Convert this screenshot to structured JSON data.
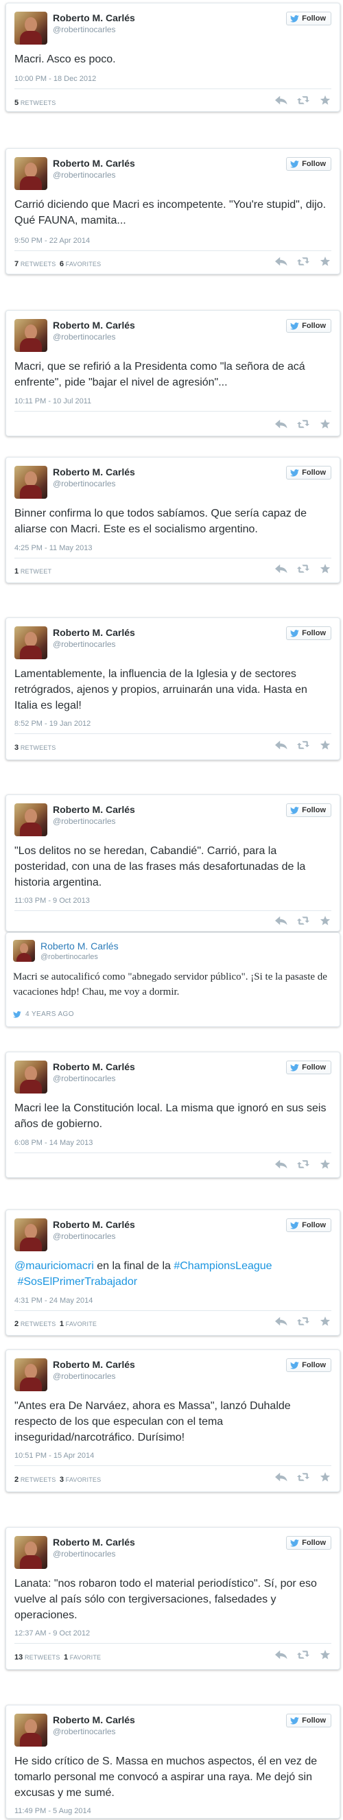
{
  "colors": {
    "link": "#1b95e0",
    "muted": "#8899a6",
    "text": "#292f33",
    "twitter_blue": "#55acee"
  },
  "follow_label": "Follow",
  "tweets": [
    {
      "name": "Roberto M. Carlés",
      "handle": "@robertinocarles",
      "text": "Macri. Asco es poco.",
      "date": "10:00 PM - 18 Dec 2012",
      "retweets": "5",
      "retweets_label": "RETWEETS",
      "favorites": "",
      "favorites_label": ""
    },
    {
      "name": "Roberto M. Carlés",
      "handle": "@robertinocarles",
      "text": "Carrió diciendo que Macri es incompetente. \"You're stupid\", dijo.  Qué FAUNA, mamita...",
      "date": "9:50 PM - 22 Apr 2014",
      "retweets": "7",
      "retweets_label": "RETWEETS",
      "favorites": "6",
      "favorites_label": "FAVORITES"
    },
    {
      "name": "Roberto M. Carlés",
      "handle": "@robertinocarles",
      "text": "Macri, que se refirió a la Presidenta como \"la señora de acá enfrente\", pide \"bajar el nivel de agresión\"...",
      "date": "10:11 PM - 10 Jul 2011",
      "retweets": "",
      "retweets_label": "",
      "favorites": "",
      "favorites_label": ""
    },
    {
      "name": "Roberto M. Carlés",
      "handle": "@robertinocarles",
      "text": "Binner confirma lo que todos sabíamos. Que sería capaz de aliarse con Macri. Este es el socialismo argentino.",
      "date": "4:25 PM - 11 May 2013",
      "retweets": "1",
      "retweets_label": "RETWEET",
      "favorites": "",
      "favorites_label": ""
    },
    {
      "name": "Roberto M. Carlés",
      "handle": "@robertinocarles",
      "text": "Lamentablemente, la influencia de la Iglesia y de sectores retrógrados, ajenos y propios, arruinarán una vida.  Hasta en Italia es legal!",
      "date": "8:52 PM - 19 Jan 2012",
      "retweets": "3",
      "retweets_label": "RETWEETS",
      "favorites": "",
      "favorites_label": ""
    },
    {
      "name": "Roberto M. Carlés",
      "handle": "@robertinocarles",
      "text": "\"Los delitos no se heredan, Cabandié\". Carrió, para la posteridad, con una de las frases más desafortunadas de la historia argentina.",
      "date": "11:03 PM - 9 Oct 2013",
      "retweets": "",
      "retweets_label": "",
      "favorites": "",
      "favorites_label": ""
    }
  ],
  "embedded": {
    "name": "Roberto M. Carlés",
    "handle": "@robertinocarles",
    "text": "Macri se autocalificó como \"abnegado servidor público\". ¡Si te la pasaste de vacaciones hdp! Chau, me voy a dormir.",
    "meta": "4 YEARS AGO"
  },
  "tweets_b": [
    {
      "name": "Roberto M. Carlés",
      "handle": "@robertinocarles",
      "text": "Macri lee la Constitución local. La misma que ignoró en sus seis años de gobierno.",
      "date": "6:08 PM - 14 May 2013",
      "retweets": "",
      "retweets_label": "",
      "favorites": "",
      "favorites_label": ""
    },
    {
      "name": "Roberto M. Carlés",
      "handle": "@robertinocarles",
      "text_parts": [
        "@mauriciomacri",
        " en la final de la ",
        "#ChampionsLeague",
        "#SosElPrimerTrabajador"
      ],
      "date": "4:31 PM - 24 May 2014",
      "retweets": "2",
      "retweets_label": "RETWEETS",
      "favorites": "1",
      "favorites_label": "FAVORITE"
    },
    {
      "name": "Roberto M. Carlés",
      "handle": "@robertinocarles",
      "text": "\"Antes era De Narváez, ahora es Massa\", lanzó Duhalde respecto de los que especulan con el tema inseguridad/narcotráfico. Durísimo!",
      "date": "10:51 PM - 15 Apr 2014",
      "retweets": "2",
      "retweets_label": "RETWEETS",
      "favorites": "3",
      "favorites_label": "FAVORITES"
    },
    {
      "name": "Roberto M. Carlés",
      "handle": "@robertinocarles",
      "text": "Lanata: \"nos robaron todo el material periodístico\".  Sí, por eso vuelve al país sólo con tergiversaciones, falsedades y operaciones.",
      "date": "12:37 AM - 9 Oct 2012",
      "retweets": "13",
      "retweets_label": "RETWEETS",
      "favorites": "1",
      "favorites_label": "FAVORITE"
    },
    {
      "name": "Roberto M. Carlés",
      "handle": "@robertinocarles",
      "text": "He sido crítico de S. Massa en muchos aspectos, él en vez de tomarlo personal me convocó a aspirar una raya. Me dejó sin excusas y me sumé.",
      "date": "11:49 PM - 5 Aug 2014",
      "retweets": "",
      "retweets_label": "",
      "favorites": "",
      "favorites_label": ""
    }
  ]
}
